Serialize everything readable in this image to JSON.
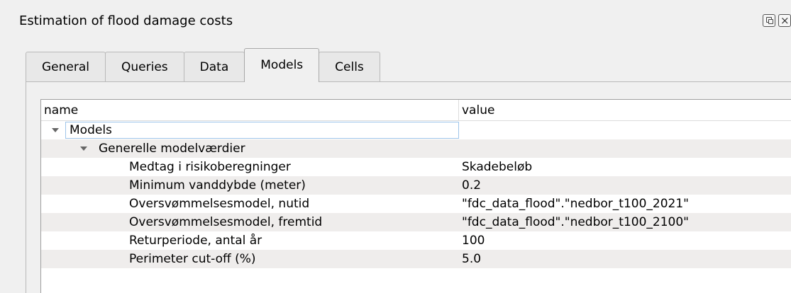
{
  "window": {
    "title": "Estimation of flood damage costs",
    "close_glyph": "×"
  },
  "tabs": [
    {
      "label": "General"
    },
    {
      "label": "Queries"
    },
    {
      "label": "Data"
    },
    {
      "label": "Models",
      "active": true
    },
    {
      "label": "Cells"
    }
  ],
  "tree": {
    "columns": {
      "name": "name",
      "value": "value"
    },
    "root": {
      "label": "Models",
      "value": ""
    },
    "group": {
      "label": "Generelle modelværdier",
      "value": ""
    },
    "rows": [
      {
        "name": "Medtag i risikoberegninger",
        "value": "Skadebeløb"
      },
      {
        "name": "Minimum vanddybde (meter)",
        "value": "0.2"
      },
      {
        "name": "Oversvømmelsesmodel, nutid",
        "value": "\"fdc_data_flood\".\"nedbor_t100_2021\""
      },
      {
        "name": "Oversvømmelsesmodel, fremtid",
        "value": "\"fdc_data_flood\".\"nedbor_t100_2100\""
      },
      {
        "name": "Returperiode, antal år",
        "value": "100"
      },
      {
        "name": "Perimeter cut-off (%)",
        "value": "5.0"
      }
    ]
  },
  "colors": {
    "selection_border": "#9ec5ea",
    "alt_row": "#efedec"
  },
  "icons": {
    "float": "float-window-icon",
    "close": "close-icon",
    "expand": "chevron-down-icon"
  }
}
